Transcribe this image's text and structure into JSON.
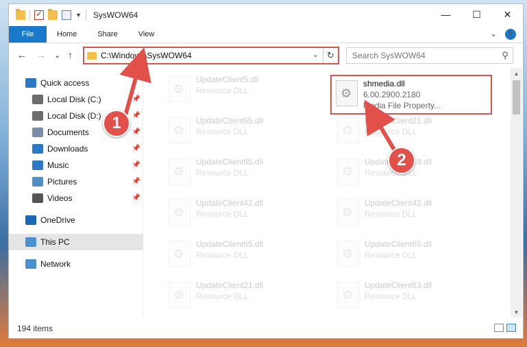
{
  "window": {
    "title": "SysWOW64",
    "controls": {
      "minimize": "—",
      "maximize": "☐",
      "close": "✕"
    }
  },
  "ribbon": {
    "file": "File",
    "tabs": [
      "Home",
      "Share",
      "View"
    ],
    "expand": "⌄",
    "help": "?"
  },
  "nav": {
    "back": "←",
    "forward": "→",
    "recent": "⌄",
    "up": "↑",
    "address": "C:\\Windows\\SysWOW64",
    "dropdown": "⌄",
    "refresh": "↻",
    "search_placeholder": "Search SysWOW64",
    "search_icon": "⚲"
  },
  "sidebar": {
    "items": [
      {
        "label": "Quick access",
        "icon": "star-icon",
        "color": "#2a78c6",
        "pinned": false
      },
      {
        "label": "Local Disk (C:)",
        "icon": "drive-icon",
        "color": "#6c6c6c",
        "pinned": true
      },
      {
        "label": "Local Disk (D:)",
        "icon": "drive-icon",
        "color": "#6c6c6c",
        "pinned": true
      },
      {
        "label": "Documents",
        "icon": "documents-icon",
        "color": "#7a8ea8",
        "pinned": true
      },
      {
        "label": "Downloads",
        "icon": "download-icon",
        "color": "#2a78c6",
        "pinned": true
      },
      {
        "label": "Music",
        "icon": "music-icon",
        "color": "#2a78c6",
        "pinned": true
      },
      {
        "label": "Pictures",
        "icon": "pictures-icon",
        "color": "#4f8fc4",
        "pinned": true
      },
      {
        "label": "Videos",
        "icon": "videos-icon",
        "color": "#555555",
        "pinned": true
      },
      {
        "label": "OneDrive",
        "icon": "cloud-icon",
        "color": "#1a66b8",
        "pinned": false
      },
      {
        "label": "This PC",
        "icon": "computer-icon",
        "color": "#4a90d0",
        "pinned": false,
        "selected": true
      },
      {
        "label": "Network",
        "icon": "network-icon",
        "color": "#4a90d0",
        "pinned": false
      }
    ],
    "pin_glyph": "📌"
  },
  "files": {
    "highlight": {
      "name": "shmedia.dll",
      "version": "6.00.2900.2180",
      "description": "Media File Property..."
    },
    "left_column": [
      {
        "name": "UpdateClient5.dll",
        "type": "Resource DLL"
      },
      {
        "name": "UpdateClient65.dll",
        "type": "Resource DLL"
      },
      {
        "name": "UpdateClient65.dll",
        "type": "Resource DLL"
      },
      {
        "name": "UpdateClient42.dll",
        "type": "Resource DLL"
      },
      {
        "name": "UpdateClient65.dll",
        "type": "Resource DLL"
      },
      {
        "name": "UpdateClient21.dll",
        "type": "Resource DLL"
      }
    ],
    "right_column": [
      {
        "name": "UpdateClient21.dll",
        "type": "Resource DLL"
      },
      {
        "name": "UpdateClient19.dll",
        "type": "Resource DLL"
      },
      {
        "name": "UpdateClient42.dll",
        "type": "Resource DLL"
      },
      {
        "name": "UpdateClient65.dll",
        "type": "Resource DLL"
      },
      {
        "name": "UpdateClient63.dll",
        "type": "Resource DLL"
      }
    ]
  },
  "status": {
    "items": "194 items"
  },
  "annotations": {
    "step1": "1",
    "step2": "2",
    "color": "#e2504a"
  }
}
